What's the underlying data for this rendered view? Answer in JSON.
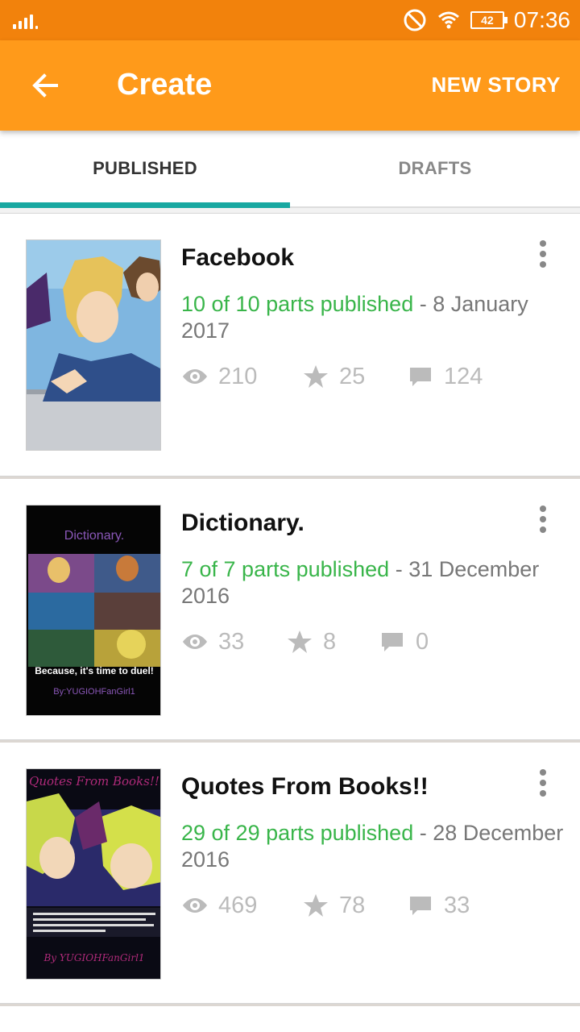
{
  "status_bar": {
    "time": "07:36",
    "battery": "42"
  },
  "app_bar": {
    "title": "Create",
    "action": "NEW STORY"
  },
  "tabs": [
    {
      "label": "PUBLISHED",
      "active": true
    },
    {
      "label": "DRAFTS",
      "active": false
    }
  ],
  "stories": [
    {
      "title": "Facebook",
      "parts": "10 of 10 parts published",
      "date": "8 January 2017",
      "views": "210",
      "votes": "25",
      "comments": "124"
    },
    {
      "title": "Dictionary.",
      "parts": "7 of 7 parts published",
      "date": "31 December 2016",
      "views": "33",
      "votes": "8",
      "comments": "0",
      "cover_title": "Dictionary.",
      "cover_caption": "Because, it's time to duel!",
      "cover_author": "By:YUGIOHFanGirl1"
    },
    {
      "title": "Quotes From Books!!",
      "parts": "29 of 29 parts published",
      "date": "28 December 2016",
      "views": "469",
      "votes": "78",
      "comments": "33",
      "cover_title": "Quotes From Books!!",
      "cover_author": "By YUGIOHFanGirl1"
    }
  ],
  "colors": {
    "status_bar": "#f2820c",
    "app_bar": "#ff9a1a",
    "tab_indicator": "#18a8a1",
    "published_green": "#39b54a"
  }
}
